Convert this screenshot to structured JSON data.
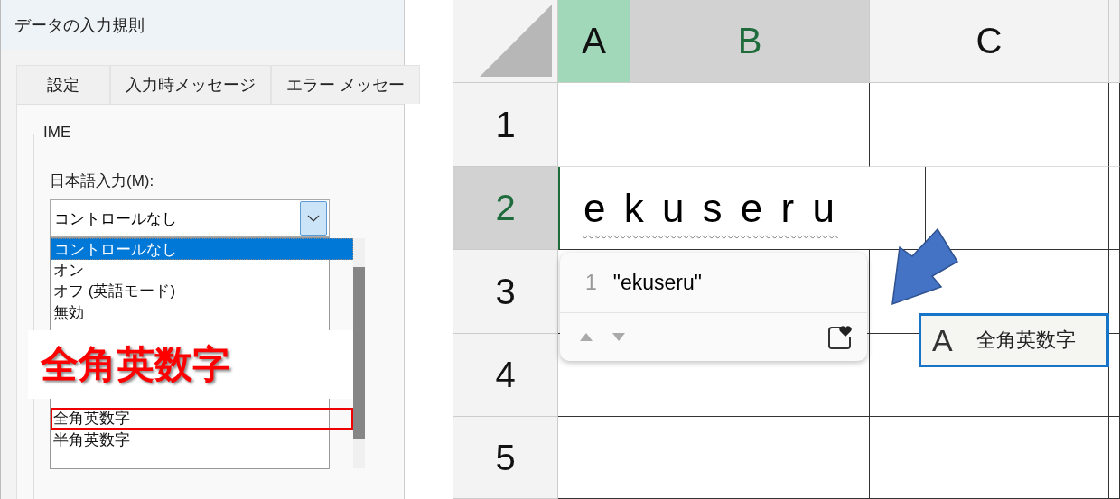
{
  "dialog": {
    "title": "データの入力規則",
    "tabs": [
      {
        "label": "設定"
      },
      {
        "label": "入力時メッセージ"
      },
      {
        "label": "エラー メッセー"
      }
    ],
    "group_label": "IME",
    "field_label": "日本語入力(M):",
    "combo": {
      "value": "コントロールなし"
    },
    "list_items": [
      {
        "kind": "option",
        "label": "コントロールなし",
        "selected": true,
        "outlined": false
      },
      {
        "kind": "option",
        "label": "オン",
        "selected": false,
        "outlined": false
      },
      {
        "kind": "option",
        "label": "オフ (英語モード)",
        "selected": false,
        "outlined": false
      },
      {
        "kind": "option",
        "label": "無効",
        "selected": false,
        "outlined": false
      },
      {
        "kind": "callout",
        "label": "全角英数字"
      },
      {
        "kind": "option",
        "label": "全角英数字",
        "selected": false,
        "outlined": true
      },
      {
        "kind": "option",
        "label": "半角英数字",
        "selected": false,
        "outlined": false
      }
    ]
  },
  "sheet": {
    "columns": [
      {
        "label": "A",
        "selected": false,
        "highlighted": true
      },
      {
        "label": "B",
        "selected": true,
        "highlighted": false
      },
      {
        "label": "C",
        "selected": false,
        "highlighted": false
      }
    ],
    "rows": [
      {
        "label": "1",
        "selected": false
      },
      {
        "label": "2",
        "selected": true
      },
      {
        "label": "3",
        "selected": false
      },
      {
        "label": "4",
        "selected": false
      },
      {
        "label": "5",
        "selected": false
      }
    ],
    "editing_text": "e k u s e r u",
    "candidates": [
      {
        "index": "1",
        "text": "\"ekuseru\""
      }
    ],
    "ime_mode": {
      "glyph": "A",
      "label": "全角英数字"
    }
  }
}
